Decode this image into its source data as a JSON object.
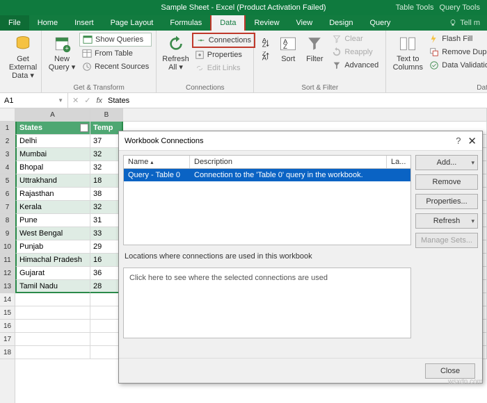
{
  "title": "Sample Sheet - Excel (Product Activation Failed)",
  "tooltabs": {
    "a": "Table Tools",
    "b": "Query Tools"
  },
  "tabs": {
    "file": "File",
    "home": "Home",
    "insert": "Insert",
    "pagelayout": "Page Layout",
    "formulas": "Formulas",
    "data": "Data",
    "review": "Review",
    "view": "View",
    "design": "Design",
    "query": "Query",
    "tellme": "Tell m"
  },
  "ribbon": {
    "getdata": "Get External Data ▾",
    "newquery": "New Query ▾",
    "showqueries": "Show Queries",
    "fromtable": "From Table",
    "recentsources": "Recent Sources",
    "gettransform": "Get & Transform",
    "refreshall": "Refresh All ▾",
    "connections": "Connections",
    "properties": "Properties",
    "editlinks": "Edit Links",
    "conngroup": "Connections",
    "sort": "Sort",
    "filter": "Filter",
    "clear": "Clear",
    "reapply": "Reapply",
    "advanced": "Advanced",
    "sortfilter": "Sort & Filter",
    "texttocolumns": "Text to Columns",
    "flashfill": "Flash Fill",
    "removedupl": "Remove Dupl",
    "datavalidation": "Data Validation",
    "datatools": "Data T"
  },
  "namebox": "A1",
  "formula": "States",
  "cols": {
    "A": "A",
    "B": "B"
  },
  "table": {
    "headers": {
      "a": "States",
      "b": "Temp"
    },
    "rows": [
      {
        "a": "Delhi",
        "b": "37"
      },
      {
        "a": "Mumbai",
        "b": "32"
      },
      {
        "a": "Bhopal",
        "b": "32"
      },
      {
        "a": "Uttrakhand",
        "b": "18"
      },
      {
        "a": "Rajasthan",
        "b": "38"
      },
      {
        "a": "Kerala",
        "b": "32"
      },
      {
        "a": "Pune",
        "b": "31"
      },
      {
        "a": "West Bengal",
        "b": "33"
      },
      {
        "a": "Punjab",
        "b": "29"
      },
      {
        "a": "Himachal Pradesh",
        "b": "16"
      },
      {
        "a": "Gujarat",
        "b": "36"
      },
      {
        "a": "Tamil Nadu",
        "b": "28"
      }
    ]
  },
  "dialog": {
    "title": "Workbook Connections",
    "cols": {
      "name": "Name",
      "desc": "Description",
      "la": "La..."
    },
    "row": {
      "name": "Query - Table 0",
      "desc": "Connection to the 'Table 0' query in the workbook."
    },
    "loclabel": "Locations where connections are used in this workbook",
    "lochint": "Click here to see where the selected connections are used",
    "btns": {
      "add": "Add...",
      "remove": "Remove",
      "properties": "Properties...",
      "refresh": "Refresh",
      "manage": "Manage Sets...",
      "close": "Close"
    }
  },
  "watermark": "wsxdn.com"
}
